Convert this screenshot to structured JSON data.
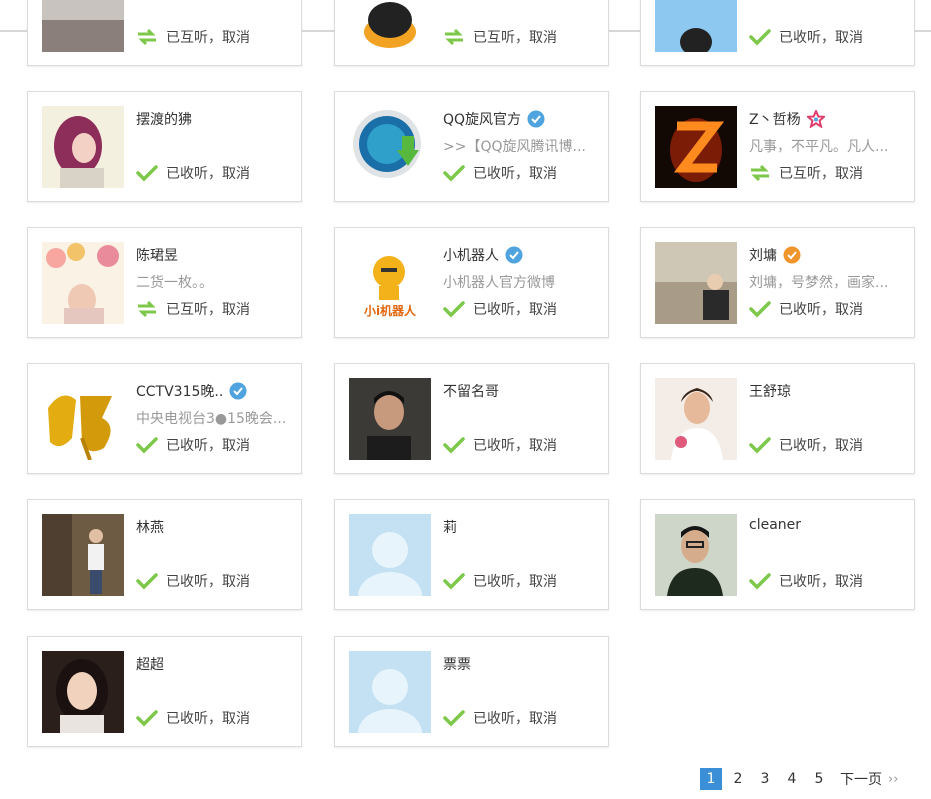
{
  "status_labels": {
    "following": "已收听，",
    "mutual": "已互听，",
    "cancel": "取消"
  },
  "partial_row": [
    {
      "status": "mutual"
    },
    {
      "status": "mutual"
    },
    {
      "status": "following"
    }
  ],
  "cards": [
    {
      "name": "摆渡的狒",
      "desc": "",
      "badge": "",
      "status": "following"
    },
    {
      "name": "QQ旋风官方",
      "desc": ">>【QQ旋风腾讯博...",
      "badge": "verified",
      "status": "following"
    },
    {
      "name": "Z丶哲杨",
      "desc": "凡事，不平凡。凡人...",
      "badge": "star",
      "status": "mutual"
    },
    {
      "name": "陈珺昱",
      "desc": "二货一枚。。",
      "badge": "",
      "status": "mutual"
    },
    {
      "name": "小机器人",
      "desc": "小机器人官方微博",
      "badge": "verified",
      "status": "following"
    },
    {
      "name": "刘墉",
      "desc": "刘墉，号梦然，画家...",
      "badge": "verified-orange",
      "status": "following"
    },
    {
      "name": "CCTV315晚..",
      "desc": "中央电视台3●15晚会...",
      "badge": "verified",
      "status": "following"
    },
    {
      "name": "不留名哥",
      "desc": "",
      "badge": "",
      "status": "following"
    },
    {
      "name": "王舒琼",
      "desc": "",
      "badge": "",
      "status": "following"
    },
    {
      "name": "林燕",
      "desc": "",
      "badge": "",
      "status": "following"
    },
    {
      "name": "莉",
      "desc": "",
      "badge": "",
      "status": "following"
    },
    {
      "name": "cleaner",
      "desc": "",
      "badge": "",
      "status": "following"
    },
    {
      "name": "超超",
      "desc": "",
      "badge": "",
      "status": "following"
    },
    {
      "name": "票票",
      "desc": "",
      "badge": "",
      "status": "following"
    }
  ],
  "robot_logo_text": "小i机器人",
  "pagination": {
    "pages": [
      "1",
      "2",
      "3",
      "4",
      "5"
    ],
    "current": "1",
    "next_label": "下一页",
    "next_arrow": "››"
  },
  "colors": {
    "verified": "#4fa3de",
    "verified_orange": "#f0952c",
    "check": "#7dc84a",
    "page_active": "#3a8fd6"
  }
}
